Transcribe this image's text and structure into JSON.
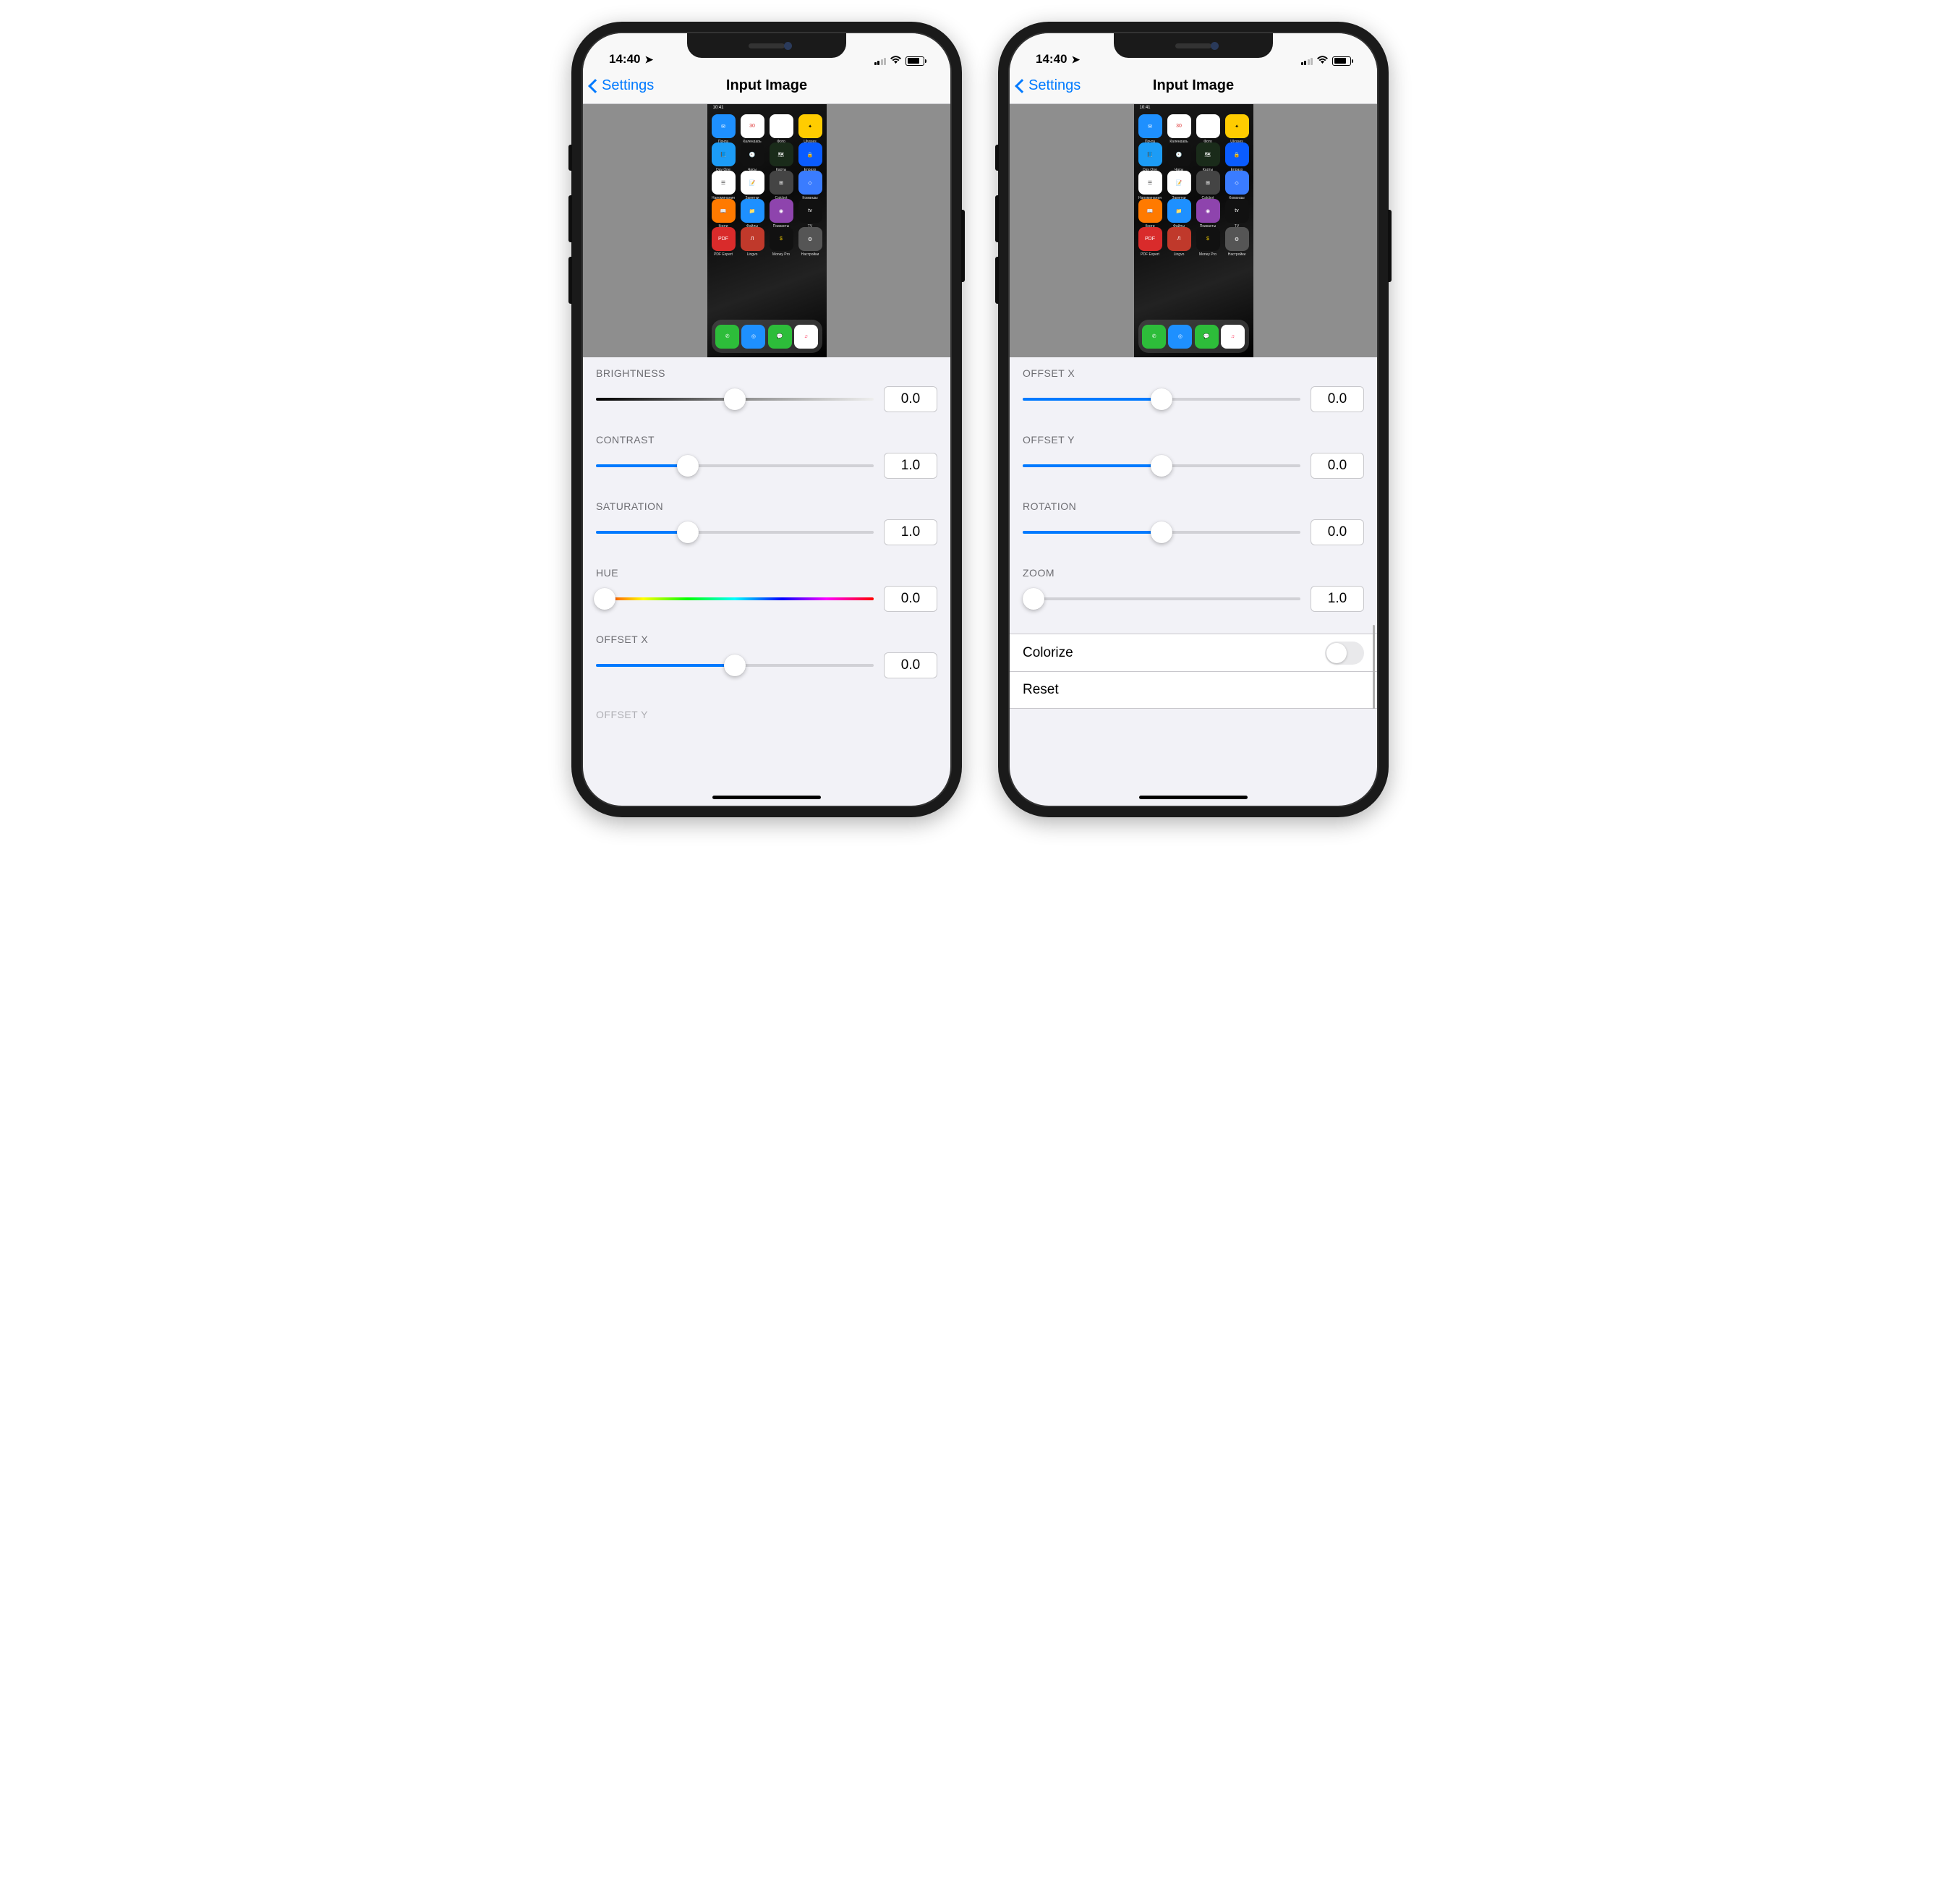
{
  "status": {
    "time": "14:40",
    "location_arrow": "➤"
  },
  "nav": {
    "back": "Settings",
    "title": "Input Image"
  },
  "preview": {
    "time": "10:41",
    "apps_r1": [
      "Почта",
      "Календарь",
      "Фото",
      "Ulysses"
    ],
    "apps_r2": [
      "Day One",
      "Часы",
      "Карты",
      "Enpass"
    ],
    "apps_r3": [
      "Напоминания",
      "Заметки",
      "Calcbot",
      "Команды"
    ],
    "apps_r4": [
      "Книги",
      "Файлы",
      "Подкасты",
      "TV"
    ],
    "apps_r5": [
      "PDF Expert",
      "Lingvo",
      "Money Pro",
      "Настройки"
    ]
  },
  "left_controls": [
    {
      "label": "BRIGHTNESS",
      "value": "0.0",
      "track": "brightness",
      "thumb_pct": 50,
      "fill_pct": 0
    },
    {
      "label": "CONTRAST",
      "value": "1.0",
      "track": "blue",
      "thumb_pct": 33,
      "fill_pct": 33
    },
    {
      "label": "SATURATION",
      "value": "1.0",
      "track": "blue",
      "thumb_pct": 33,
      "fill_pct": 33
    },
    {
      "label": "HUE",
      "value": "0.0",
      "track": "hue",
      "thumb_pct": 3,
      "fill_pct": 0
    },
    {
      "label": "OFFSET X",
      "value": "0.0",
      "track": "blue",
      "thumb_pct": 50,
      "fill_pct": 50
    }
  ],
  "left_partial_next": "OFFSET Y",
  "right_controls": [
    {
      "label": "OFFSET X",
      "value": "0.0",
      "track": "blue",
      "thumb_pct": 50,
      "fill_pct": 50
    },
    {
      "label": "OFFSET Y",
      "value": "0.0",
      "track": "blue",
      "thumb_pct": 50,
      "fill_pct": 50
    },
    {
      "label": "ROTATION",
      "value": "0.0",
      "track": "blue",
      "thumb_pct": 50,
      "fill_pct": 50
    },
    {
      "label": "ZOOM",
      "value": "1.0",
      "track": "blue",
      "thumb_pct": 4,
      "fill_pct": 0
    }
  ],
  "right_list": {
    "colorize": "Colorize",
    "reset": "Reset"
  },
  "colors": {
    "accent": "#007AFF"
  }
}
